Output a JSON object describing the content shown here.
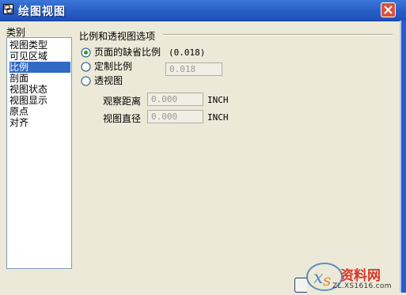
{
  "window": {
    "title": "绘图视图"
  },
  "category": {
    "label": "类别",
    "items": [
      "视图类型",
      "可见区域",
      "比例",
      "剖面",
      "视图状态",
      "视图显示",
      "原点",
      "对齐"
    ],
    "selected_index": 2
  },
  "scale_options": {
    "group_label": "比例和透视图选项",
    "default_page_scale": {
      "label": "页面的缺省比例",
      "value": "(0.018)",
      "selected": true
    },
    "custom_scale": {
      "label": "定制比例",
      "value": "0.018",
      "selected": false
    },
    "perspective": {
      "label": "透视图",
      "selected": false
    },
    "view_distance": {
      "label": "观察距离",
      "value": "0.000",
      "unit": "INCH"
    },
    "view_diameter": {
      "label": "视图直径",
      "value": "0.000",
      "unit": "INCH"
    }
  },
  "watermark": {
    "brand": "资料网",
    "url": "ZL.XS1616.com"
  },
  "colors": {
    "titlebar": "#2b5fc7",
    "selection": "#316ac5",
    "face": "#ece9d8",
    "close": "#d8523c"
  }
}
